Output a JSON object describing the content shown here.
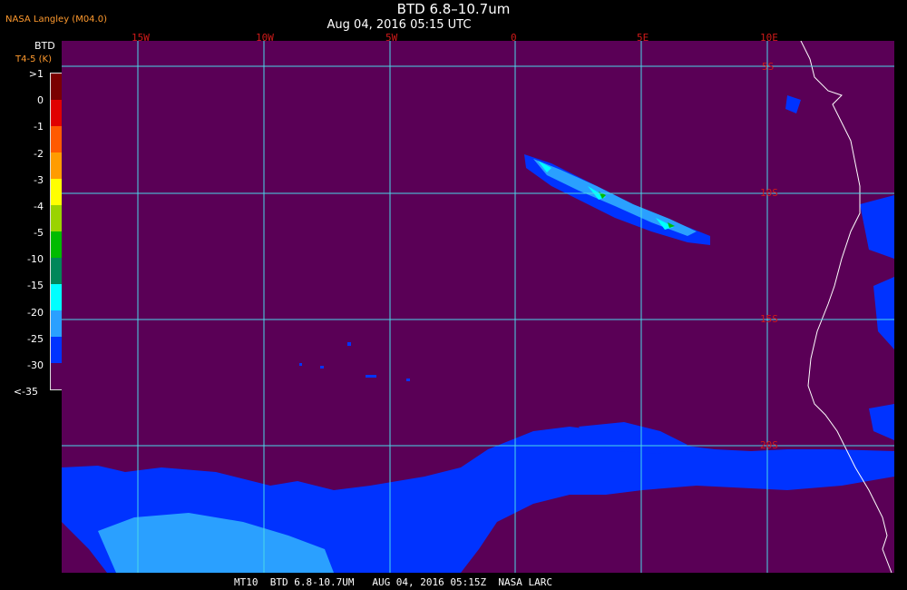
{
  "header": {
    "title": "BTD 6.8–10.7um",
    "datetime": "Aug 04, 2016 05:15 UTC",
    "source": "NASA Langley (M04.0)"
  },
  "legend": {
    "title": "BTD",
    "subtitle": "T4-5 (K)",
    "labels": [
      ">1",
      "0",
      "-1",
      "-2",
      "-3",
      "-4",
      "-5",
      "-10",
      "-15",
      "-20",
      "-25",
      "-30",
      "<-35"
    ],
    "colors": [
      "#7a0000",
      "#e00000",
      "#ff5a00",
      "#ff9c00",
      "#ffff00",
      "#9ad300",
      "#00bb00",
      "#00875a",
      "#00ffff",
      "#2aa0ff",
      "#0033ff",
      "#5a0056"
    ]
  },
  "map": {
    "background_color": "#5a0056",
    "gridline_color": "#4ad8e8",
    "coastline_color": "#ffffff",
    "longitude_labels": [
      "15W",
      "10W",
      "5W",
      "0",
      "5E",
      "10E"
    ],
    "latitude_labels": [
      "5S",
      "10S",
      "15S",
      "20S"
    ]
  },
  "footer": {
    "text": "MT10  BTD 6.8-10.7UM   AUG 04, 2016 05:15Z  NASA LARC"
  }
}
